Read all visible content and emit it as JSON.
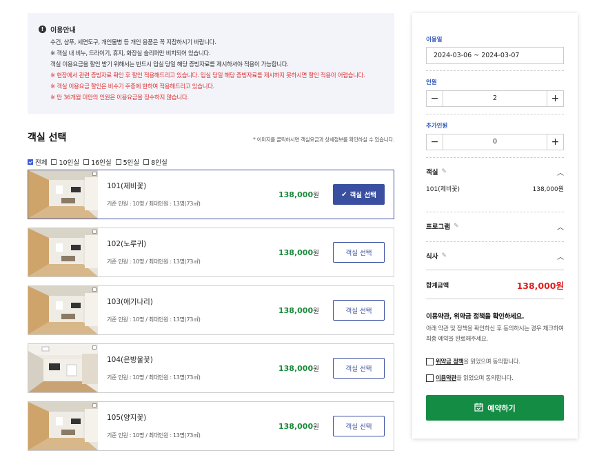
{
  "notice": {
    "icon": "info-icon",
    "title": "이용안내",
    "lines": [
      {
        "text": "수건, 샴푸, 세면도구, 개인물병 등 개인 용품은 꼭 지참하시기 바랍니다.",
        "red": false
      },
      {
        "text": "※ 객실 내 비누, 드라이기, 휴지, 화장실 슬리퍼만 비치되어 있습니다.",
        "red": false
      },
      {
        "text": "객실 이용요금을 할인 받기 위해서는 반드시 입실 당일 해당 증빙자료를 제시하셔야 적용이 가능합니다.",
        "red": false
      },
      {
        "text": "※ 현장에서 관련 증빙자료 확인 후 할인 적용해드리고 있습니다. 입실 당일 해당 증빙자료를 제시하지 못하시면 할인 적용이 어렵습니다.",
        "red": true
      },
      {
        "text": "※ 객실 이용요금 할인은 비수기 주중에 한하여 적용해드리고 있습니다.",
        "red": true
      },
      {
        "text": "※ 만 36개월 미만의 인원은 이용요금을 징수하지 않습니다.",
        "red": true
      }
    ]
  },
  "section": {
    "title": "객실 선택",
    "hint": "* 이미지를 클릭하시면 객실요금과 상세정보를 확인하실 수 있습니다."
  },
  "filters": [
    {
      "label": "전체",
      "checked": true
    },
    {
      "label": "10인실",
      "checked": false
    },
    {
      "label": "16인실",
      "checked": false
    },
    {
      "label": "5인실",
      "checked": false
    },
    {
      "label": "8인실",
      "checked": false
    }
  ],
  "rooms": [
    {
      "name": "101(제비꽃)",
      "capacity": "기준 인원 : 10명 / 최대인원 : 13명(73㎡)",
      "price": "138,000",
      "won": "원",
      "button": "객실 선택",
      "selected": true
    },
    {
      "name": "102(노루귀)",
      "capacity": "기준 인원 : 10명 / 최대인원 : 13명(73㎡)",
      "price": "138,000",
      "won": "원",
      "button": "객실 선택",
      "selected": false
    },
    {
      "name": "103(애기나리)",
      "capacity": "기준 인원 : 10명 / 최대인원 : 13명(73㎡)",
      "price": "138,000",
      "won": "원",
      "button": "객실 선택",
      "selected": false
    },
    {
      "name": "104(은방울꽃)",
      "capacity": "기준 인원 : 10명 / 최대인원 : 13명(73㎡)",
      "price": "138,000",
      "won": "원",
      "button": "객실 선택",
      "selected": false
    },
    {
      "name": "105(양지꽃)",
      "capacity": "기준 인원 : 10명 / 최대인원 : 13명(73㎡)",
      "price": "138,000",
      "won": "원",
      "button": "객실 선택",
      "selected": false
    }
  ],
  "sidebar": {
    "date_label": "이용일",
    "date_value": "2024-03-06 ~ 2024-03-07",
    "people_label": "인원",
    "people_value": "2",
    "extra_label": "추가인원",
    "extra_value": "0",
    "minus": "−",
    "plus": "+",
    "room_group": "객실",
    "room_item_name": "101(제비꽃)",
    "room_item_price": "138,000원",
    "program_group": "프로그램",
    "meal_group": "식사",
    "total_label": "합계금액",
    "total_value": "138,000원",
    "terms_title": "이용약관, 위약금 정책을 확인하세요.",
    "terms_desc": "아래 약관 및 정책을 확인하신 후 동의하시는 경우 체크하여 최종 예약을 완료해주세요.",
    "agree1_link": "위약금 정책",
    "agree1_rest": "을 읽었으며 동의합니다.",
    "agree2_link": "이용약관",
    "agree2_rest": "을 읽었으며 동의합니다.",
    "reserve_label": "예약하기"
  },
  "colors": {
    "accent": "#3a4fa0",
    "price_green": "#1a8a3a",
    "total_red": "#e01e1e",
    "reserve_green": "#148c44",
    "notice_bg": "#f2f4fa",
    "sidebar_label_blue": "#2d55b8"
  }
}
